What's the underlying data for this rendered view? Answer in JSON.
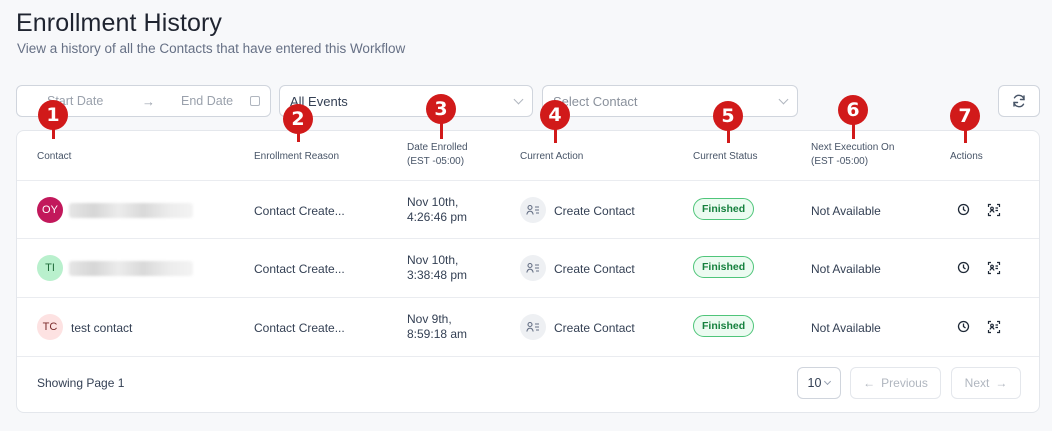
{
  "page": {
    "title": "Enrollment History",
    "subtitle": "View a history of all the Contacts that have entered this Workflow"
  },
  "filters": {
    "start_date": "Start Date",
    "end_date": "End Date",
    "events": "All Events",
    "contact": "Select Contact"
  },
  "table": {
    "headers": {
      "contact": "Contact",
      "reason": "Enrollment Reason",
      "date_line1": "Date Enrolled",
      "date_line2": "(EST -05:00)",
      "current_action": "Current Action",
      "current_status": "Current Status",
      "next_exec_line1": "Next Execution On",
      "next_exec_line2": "(EST -05:00)",
      "actions": "Actions"
    },
    "rows": [
      {
        "initials": "OY",
        "name": "",
        "reason": "Contact Create...",
        "date_line1": "Nov 10th,",
        "date_line2": "4:26:46 pm",
        "action": "Create Contact",
        "status": "Finished",
        "next": "Not Available"
      },
      {
        "initials": "TI",
        "name": "",
        "reason": "Contact Create...",
        "date_line1": "Nov 10th,",
        "date_line2": "3:38:48 pm",
        "action": "Create Contact",
        "status": "Finished",
        "next": "Not Available"
      },
      {
        "initials": "TC",
        "name": "test contact",
        "reason": "Contact Create...",
        "date_line1": "Nov 9th,",
        "date_line2": "8:59:18 am",
        "action": "Create Contact",
        "status": "Finished",
        "next": "Not Available"
      }
    ]
  },
  "pagination": {
    "showing": "Showing Page 1",
    "page_size": "10",
    "previous": "Previous",
    "next": "Next"
  },
  "markers": [
    "1",
    "2",
    "3",
    "4",
    "5",
    "6",
    "7"
  ],
  "colors": {
    "avatar_oy_bg": "#c2185b",
    "avatar_ti_bg": "#b9f0cd",
    "avatar_tc_bg": "#fde2e2",
    "status_green": "#15803d",
    "marker_red": "#d11a1a"
  }
}
